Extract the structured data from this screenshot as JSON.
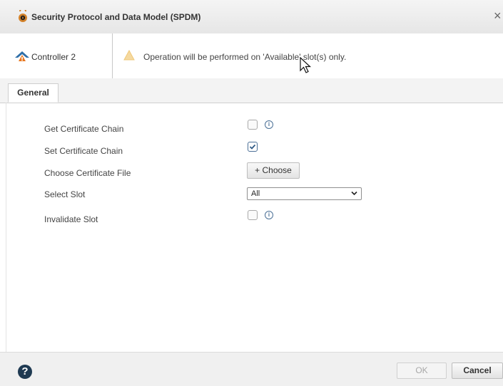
{
  "dialog": {
    "title": "Security Protocol and Data Model (SPDM)",
    "close_glyph": "×"
  },
  "info_bar": {
    "controller_label": "Controller 2",
    "message": "Operation will be performed on 'Available' slot(s) only."
  },
  "tabs": [
    {
      "label": "General",
      "selected": true
    }
  ],
  "form": {
    "rows": [
      {
        "label": "Get Certificate Chain",
        "control": "checkbox",
        "checked": false,
        "info_icon": true
      },
      {
        "label": "Set Certificate Chain",
        "control": "checkbox",
        "checked": true,
        "info_icon": false
      },
      {
        "label": "Choose Certificate File",
        "control": "button",
        "button_label": "+ Choose"
      },
      {
        "label": "Select Slot",
        "control": "select",
        "selected_value": "All"
      },
      {
        "label": "Invalidate Slot",
        "control": "checkbox",
        "checked": false,
        "info_icon": true
      }
    ]
  },
  "footer": {
    "help_glyph": "?",
    "ok_label": "OK",
    "ok_enabled": false,
    "cancel_label": "Cancel"
  },
  "icons": {
    "title": "security-lock-icon",
    "controller": "controller-icon",
    "warning": "warning-triangle-icon",
    "info": "info-icon",
    "help": "help-icon",
    "cursor": "mouse-pointer-icon",
    "dropdown": "chevron-down-icon"
  },
  "colors": {
    "accent": "#4a6f96",
    "warning": "#f0b429",
    "help_icon": "#1f3a52",
    "title_icon": "#d3822a"
  }
}
